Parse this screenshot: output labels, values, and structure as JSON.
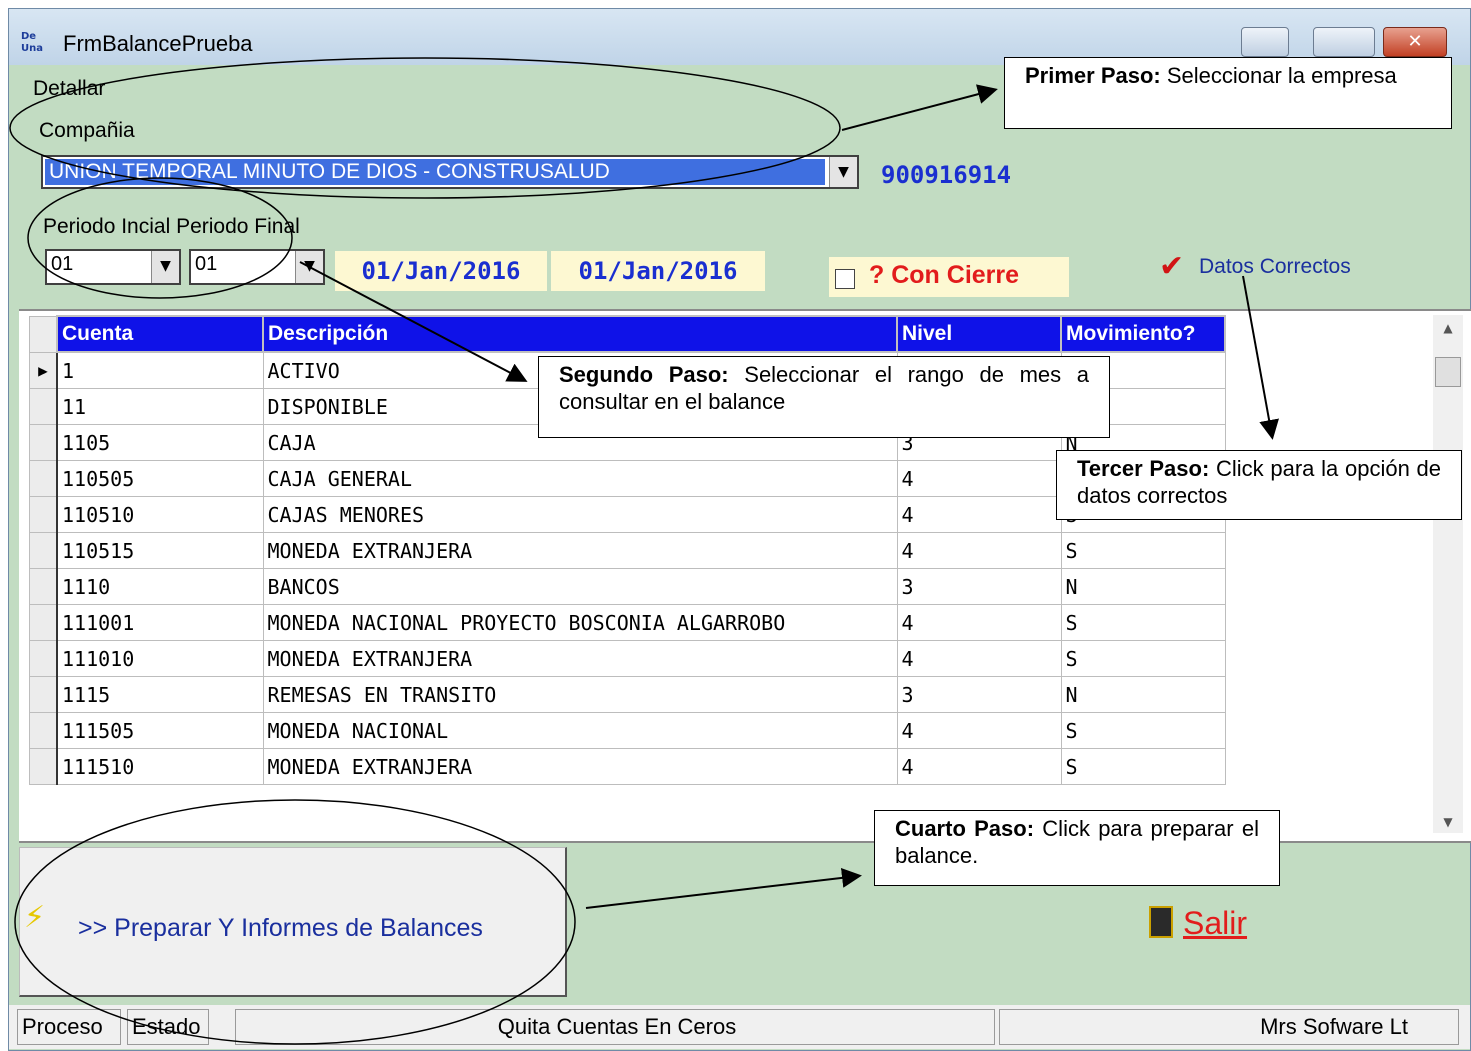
{
  "window": {
    "title": "FrmBalancePrueba",
    "app_icon_text": "De Una"
  },
  "menu": {
    "items": [
      "Detallar"
    ]
  },
  "company": {
    "label": "Compañia",
    "selected": "UNION TEMPORAL MINUTO DE DIOS - CONSTRUSALUD",
    "nit": "900916914"
  },
  "period": {
    "label": "Periodo Incial Periodo Final",
    "initial": "01",
    "final": "01",
    "initial_date": "01/Jan/2016",
    "final_date": "01/Jan/2016"
  },
  "con_cierre": {
    "label": "? Con Cierre",
    "checked": false
  },
  "datos_correctos": {
    "label": "Datos Correctos"
  },
  "grid": {
    "columns": [
      "Cuenta",
      "Descripción",
      "Nivel",
      "Movimiento?"
    ],
    "rows": [
      {
        "cuenta": "1",
        "descripcion": "ACTIVO",
        "nivel": "",
        "movimiento": ""
      },
      {
        "cuenta": "11",
        "descripcion": "DISPONIBLE",
        "nivel": "",
        "movimiento": ""
      },
      {
        "cuenta": "1105",
        "descripcion": "CAJA",
        "nivel": "3",
        "movimiento": "N"
      },
      {
        "cuenta": "110505",
        "descripcion": "CAJA GENERAL",
        "nivel": "4",
        "movimiento": ""
      },
      {
        "cuenta": "110510",
        "descripcion": "CAJAS MENORES",
        "nivel": "4",
        "movimiento": "S"
      },
      {
        "cuenta": "110515",
        "descripcion": "MONEDA EXTRANJERA",
        "nivel": "4",
        "movimiento": "S"
      },
      {
        "cuenta": "1110",
        "descripcion": "BANCOS",
        "nivel": "3",
        "movimiento": "N"
      },
      {
        "cuenta": "111001",
        "descripcion": "MONEDA NACIONAL PROYECTO BOSCONIA ALGARROBO",
        "nivel": "4",
        "movimiento": "S"
      },
      {
        "cuenta": "111010",
        "descripcion": "MONEDA EXTRANJERA",
        "nivel": "4",
        "movimiento": "S"
      },
      {
        "cuenta": "1115",
        "descripcion": "REMESAS EN TRANSITO",
        "nivel": "3",
        "movimiento": "N"
      },
      {
        "cuenta": "111505",
        "descripcion": "MONEDA NACIONAL",
        "nivel": "4",
        "movimiento": "S"
      },
      {
        "cuenta": "111510",
        "descripcion": "MONEDA EXTRANJERA",
        "nivel": "4",
        "movimiento": "S"
      }
    ]
  },
  "buttons": {
    "preparar": ">> Preparar Y Informes de Balances",
    "salir": "Salir"
  },
  "statusbar": {
    "proceso": "Proceso",
    "estado": "Estado",
    "message": "Quita Cuentas En Ceros",
    "company": "Mrs Sofware Lt"
  },
  "callouts": {
    "primer": {
      "bold": "Primer Paso:",
      "text": " Seleccionar la empresa"
    },
    "segundo": {
      "bold": "Segundo Paso:",
      "text": " Seleccionar el rango de mes a consultar en el balance"
    },
    "tercer": {
      "bold": "Tercer Paso:",
      "text": " Click para la opción de datos correctos"
    },
    "cuarto": {
      "bold": "Cuarto Paso:",
      "text": " Click para preparar el balance."
    }
  },
  "colors": {
    "form_bg": "#c2dcc2",
    "grid_header": "#0f12e8",
    "accent_blue": "#1a2fd0",
    "accent_red": "#e21c1c"
  }
}
